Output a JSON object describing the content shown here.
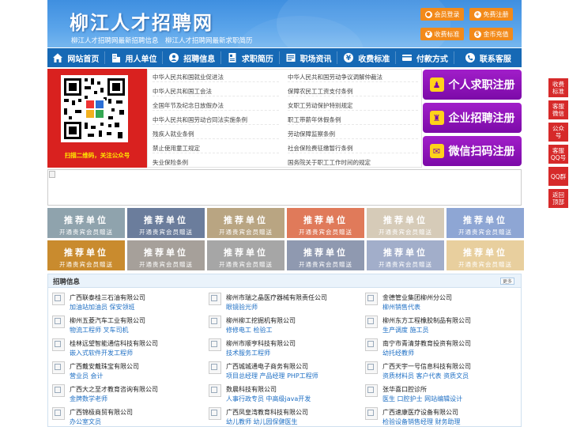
{
  "header": {
    "site_title": "柳江人才招聘网",
    "marquee": "柳江人才招聘网最新招聘信息　柳江人才招聘网最新求职简历",
    "buttons": {
      "member_login": "会员登录",
      "free_register": "免费注册",
      "fee_standard": "收费标准",
      "coin_recharge": "金币充值"
    }
  },
  "nav": {
    "items": [
      {
        "label": "网站首页",
        "icon": "home-icon"
      },
      {
        "label": "用人单位",
        "icon": "building-icon"
      },
      {
        "label": "招聘信息",
        "icon": "recruit-icon"
      },
      {
        "label": "求职简历",
        "icon": "resume-icon"
      },
      {
        "label": "职场资讯",
        "icon": "news-icon"
      },
      {
        "label": "收费标准",
        "icon": "money-icon"
      },
      {
        "label": "付款方式",
        "icon": "card-icon"
      },
      {
        "label": "联系客服",
        "icon": "phone-icon"
      }
    ]
  },
  "qr": {
    "caption": "扫描二维码，关注公众号"
  },
  "laws": {
    "left": [
      "中华人民共和国就业促进法",
      "中华人民共和国工会法",
      "全国年节及纪念日放假办法",
      "中华人民共和国劳动合同法实施条例",
      "残疾人就业条例",
      "禁止使用童工规定",
      "失业保险条例"
    ],
    "right": [
      "中华人民共和国劳动争议调解仲裁法",
      "保障农民工工资支付条例",
      "女职工劳动保护特别规定",
      "职工带薪年休假条例",
      "劳动保障监察条例",
      "社会保险费征缴暂行条例",
      "国务院关于职工工作时间的规定"
    ]
  },
  "register": {
    "personal": "个人求职注册",
    "company": "企业招聘注册",
    "wechat": "微信扫码注册"
  },
  "recommend": {
    "title": "推荐单位",
    "subtitle": "开通贵宾会员赠送",
    "colors": [
      "#8fa3ad",
      "#6b7d9c",
      "#b9a582",
      "#e07a5a",
      "#d6cbb8",
      "#8ea6d4",
      "#c98b2e",
      "#a6a09a",
      "#a6a6a6",
      "#8f99b0",
      "#a2aeca",
      "#e8cf9e"
    ]
  },
  "jobs": {
    "title": "招聘信息",
    "more": "更多",
    "columns": [
      [
        {
          "company": "广西联泰桂三石油有限公司",
          "positions": "加油站加油员 保安领班"
        },
        {
          "company": "柳州五菱汽车工业有限公司",
          "positions": "物流工程师 叉车司机"
        },
        {
          "company": "桂林远望智能通信科技有限公司",
          "positions": "嵌入式软件开发工程师"
        },
        {
          "company": "广西戴安戴珠宝有限公司",
          "positions": "营业员 会计"
        },
        {
          "company": "广西大之至才教育咨询有限公司",
          "positions": "金牌数学老师"
        },
        {
          "company": "广西锦极商贸有限公司",
          "positions": "办公室文员"
        }
      ],
      [
        {
          "company": "柳州市瑞之晶医疗器械有限责任公司",
          "positions": "眼镜验光师"
        },
        {
          "company": "柳州柳工挖掘机有限公司",
          "positions": "修修电工 检验工"
        },
        {
          "company": "柳州市顺亨科技有限公司",
          "positions": "技术服务工程师"
        },
        {
          "company": "广西城城通电子商务有限公司",
          "positions": "项目总经理 产品经理 PHP工程师"
        },
        {
          "company": "数晨科技有限公司",
          "positions": "人事行政专员 中高级java开发"
        },
        {
          "company": "广西凤皇湾教育科技有限公司",
          "positions": "幼儿教师 幼儿园保健医生"
        }
      ],
      [
        {
          "company": "金德管业集团柳州分公司",
          "positions": "柳州销售代表"
        },
        {
          "company": "柳州东方工程橡胶制品有限公司",
          "positions": "生产调度 施工员"
        },
        {
          "company": "南宁市青清芽教育投资有限公司",
          "positions": "幼托经教师"
        },
        {
          "company": "广西天宇一号信息科技有限公司",
          "positions": "资质材料员 客户代表 资质文员"
        },
        {
          "company": "张华喜口腔诊所",
          "positions": "医生 口腔护士 网站编辑设计"
        },
        {
          "company": "广西速康医疗设备有限公司",
          "positions": "检验设备销售经理 财务助理"
        }
      ]
    ]
  },
  "side": {
    "items": [
      "收费标准",
      "客服微信",
      "公众号",
      "客服QQ号",
      "QQ群",
      "返回顶部"
    ]
  }
}
